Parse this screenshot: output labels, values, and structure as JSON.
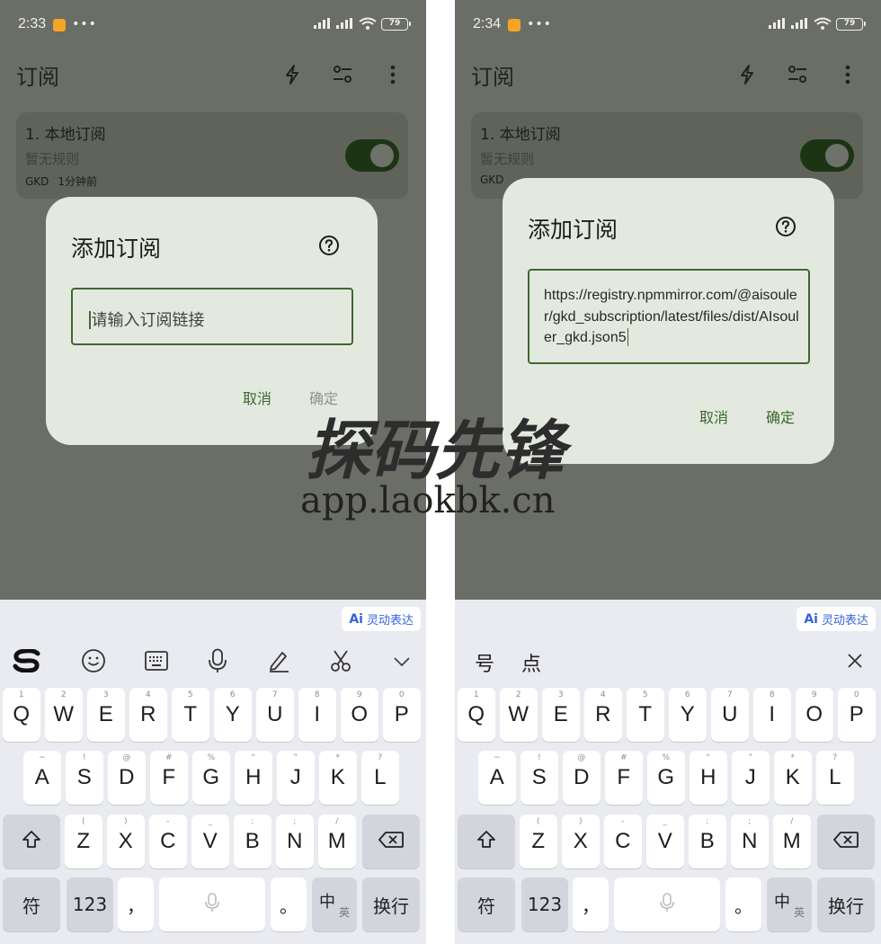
{
  "left": {
    "status": {
      "time": "2:33",
      "battery": "79"
    },
    "appbar": {
      "title": "订阅"
    },
    "card": {
      "title": "1. 本地订阅",
      "desc": "暂无规则",
      "meta_source": "GKD",
      "meta_time": "1分钟前"
    },
    "dialog": {
      "title": "添加订阅",
      "placeholder": "请输入订阅链接",
      "cancel": "取消",
      "confirm": "确定"
    }
  },
  "right": {
    "status": {
      "time": "2:34",
      "battery": "79"
    },
    "appbar": {
      "title": "订阅"
    },
    "card": {
      "title": "1. 本地订阅",
      "desc": "暂无规则",
      "meta_source": "GKD"
    },
    "dialog": {
      "title": "添加订阅",
      "value": "https://registry.npmmirror.com/@aisouler/gkd_subscription/latest/files/dist/AIsouler_gkd.json5",
      "cancel": "取消",
      "confirm": "确定"
    },
    "candidates": [
      "号",
      "点"
    ]
  },
  "keyboard": {
    "ai_chip": {
      "icon": "Ai",
      "label": "灵动表达"
    },
    "row1": [
      {
        "k": "Q",
        "h": "1"
      },
      {
        "k": "W",
        "h": "2"
      },
      {
        "k": "E",
        "h": "3"
      },
      {
        "k": "R",
        "h": "4"
      },
      {
        "k": "T",
        "h": "5"
      },
      {
        "k": "Y",
        "h": "6"
      },
      {
        "k": "U",
        "h": "7"
      },
      {
        "k": "I",
        "h": "8"
      },
      {
        "k": "O",
        "h": "9"
      },
      {
        "k": "P",
        "h": "0"
      }
    ],
    "row2": [
      {
        "k": "A",
        "h": "~"
      },
      {
        "k": "S",
        "h": "!"
      },
      {
        "k": "D",
        "h": "@"
      },
      {
        "k": "F",
        "h": "#"
      },
      {
        "k": "G",
        "h": "%"
      },
      {
        "k": "H",
        "h": "“"
      },
      {
        "k": "J",
        "h": "”"
      },
      {
        "k": "K",
        "h": "*"
      },
      {
        "k": "L",
        "h": "?"
      }
    ],
    "row3": [
      {
        "k": "Z",
        "h": "("
      },
      {
        "k": "X",
        "h": ")"
      },
      {
        "k": "C",
        "h": "-"
      },
      {
        "k": "V",
        "h": "_"
      },
      {
        "k": "B",
        "h": ":"
      },
      {
        "k": "N",
        "h": ";"
      },
      {
        "k": "M",
        "h": "/"
      }
    ],
    "symbols_label": "符",
    "numbers_label": "123",
    "comma_label": "，",
    "period_label": "。",
    "lang_main": "中",
    "lang_sub": "英",
    "enter_label": "换行"
  },
  "watermark": {
    "title": "探码先锋",
    "url": "app.laokbk.cn"
  },
  "colors": {
    "accent": "#3c6a2d",
    "scrim": "#6b6e66",
    "dialog": "#e4e9e0",
    "keyboard": "#e9ebf0"
  }
}
